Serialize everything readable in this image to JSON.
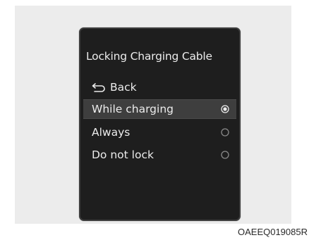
{
  "screen": {
    "title": "Locking Charging Cable",
    "back_label": "Back",
    "back_icon": "return-arrow-icon",
    "options": [
      {
        "label": "While charging",
        "selected": true
      },
      {
        "label": "Always",
        "selected": false
      },
      {
        "label": "Do not lock",
        "selected": false
      }
    ]
  },
  "caption": "OAEEQ019085R",
  "colors": {
    "screen_background": "#1e1e1e",
    "selected_row": "#3e3e3e",
    "text": "#ececec",
    "panel": "#ececec"
  }
}
